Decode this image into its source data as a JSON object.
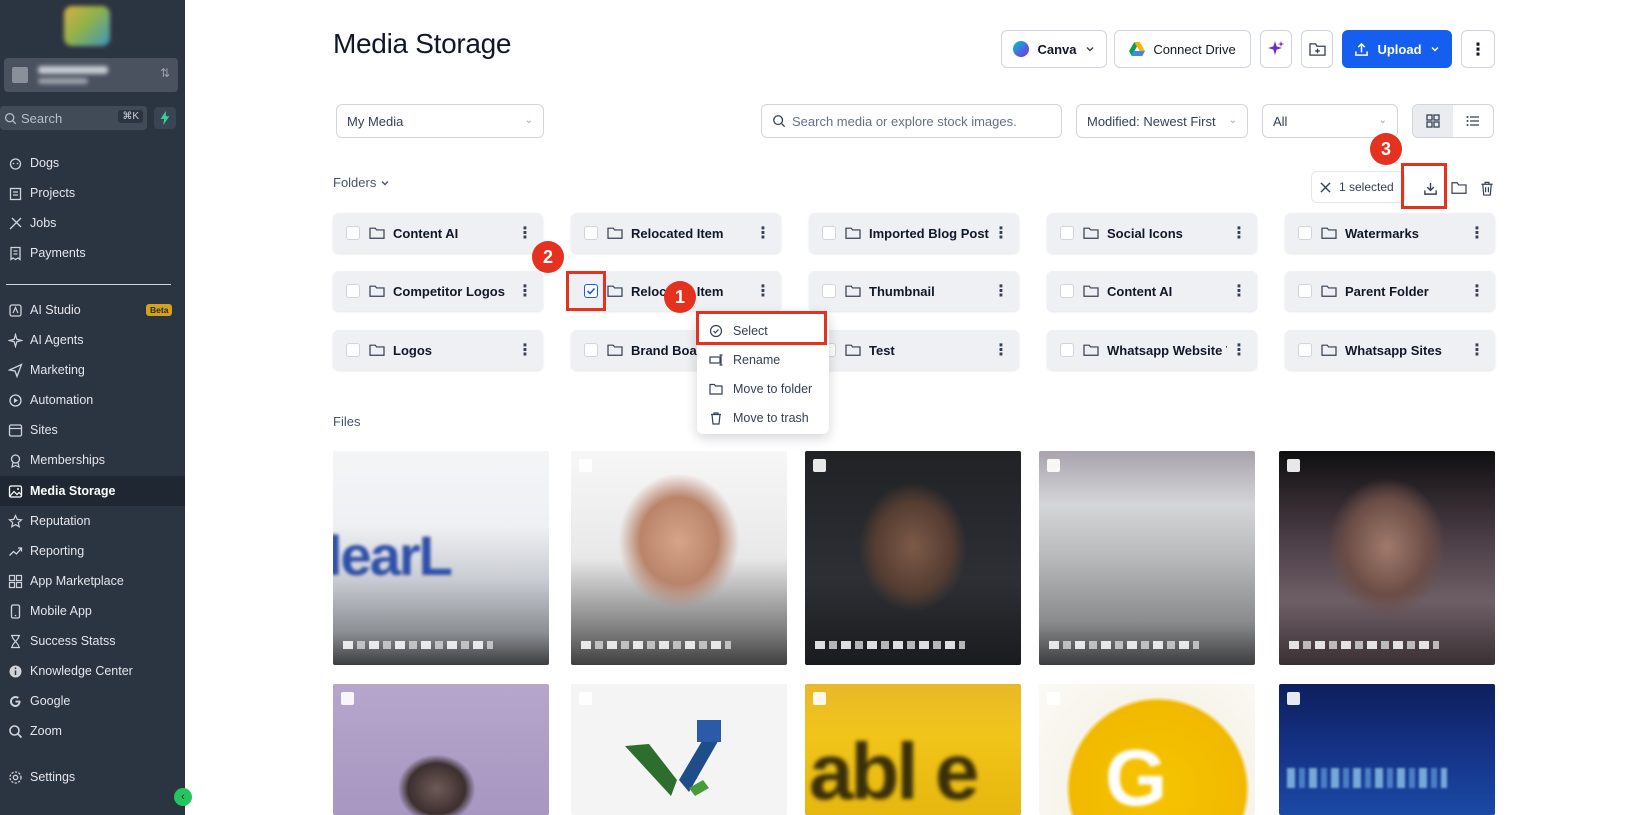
{
  "sidebar": {
    "search_placeholder": "Search",
    "search_shortcut": "⌘K",
    "items": [
      {
        "label": "Dogs",
        "icon": "dog-icon"
      },
      {
        "label": "Projects",
        "icon": "clipboard-icon"
      },
      {
        "label": "Jobs",
        "icon": "tools-icon"
      },
      {
        "label": "Payments",
        "icon": "receipt-icon"
      },
      {
        "label": "AI Studio",
        "icon": "ai-studio-icon",
        "badge": "Beta"
      },
      {
        "label": "AI Agents",
        "icon": "sparkle-icon"
      },
      {
        "label": "Marketing",
        "icon": "send-icon"
      },
      {
        "label": "Automation",
        "icon": "automation-icon"
      },
      {
        "label": "Sites",
        "icon": "globe-window-icon"
      },
      {
        "label": "Memberships",
        "icon": "award-icon"
      },
      {
        "label": "Media Storage",
        "icon": "image-icon",
        "active": true
      },
      {
        "label": "Reputation",
        "icon": "star-icon"
      },
      {
        "label": "Reporting",
        "icon": "trend-icon"
      },
      {
        "label": "App Marketplace",
        "icon": "grid-plus-icon"
      },
      {
        "label": "Mobile App",
        "icon": "phone-icon"
      },
      {
        "label": "Success Statss",
        "icon": "hourglass-icon"
      },
      {
        "label": "Knowledge Center",
        "icon": "info-icon"
      },
      {
        "label": "Google",
        "icon": "google-icon"
      },
      {
        "label": "Zoom",
        "icon": "zoom-icon"
      },
      {
        "label": "Settings",
        "icon": "gear-icon"
      }
    ]
  },
  "header": {
    "title": "Media Storage",
    "canva_label": "Canva",
    "connect_drive_label": "Connect Drive",
    "upload_label": "Upload"
  },
  "filters": {
    "source": "My Media",
    "search_placeholder": "Search media or explore stock images.",
    "sort": "Modified: Newest First",
    "type": "All"
  },
  "folders_label": "Folders",
  "selection": {
    "count_label": "1 selected"
  },
  "folders": [
    [
      "Content AI",
      "Relocated Item",
      "Imported Blog Post",
      "Social Icons",
      "Watermarks"
    ],
    [
      "Competitor Logos",
      "Relocated Item",
      "Thumbnail",
      "Content AI",
      "Parent Folder"
    ],
    [
      "Logos",
      "Brand Board",
      "Test",
      "Whatsapp Website Te...",
      "Whatsapp Sites"
    ]
  ],
  "context_menu": [
    {
      "label": "Select",
      "icon": "check-circle-icon"
    },
    {
      "label": "Rename",
      "icon": "rename-icon"
    },
    {
      "label": "Move to folder",
      "icon": "folder-icon"
    },
    {
      "label": "Move to trash",
      "icon": "trash-icon"
    }
  ],
  "callouts": [
    "1",
    "2",
    "3"
  ],
  "files_label": "Files",
  "colors": {
    "sidebar_bg": "#2b3441",
    "accent": "#155eef",
    "highlight": "#e5311f",
    "ai_green": "#22c55e"
  }
}
